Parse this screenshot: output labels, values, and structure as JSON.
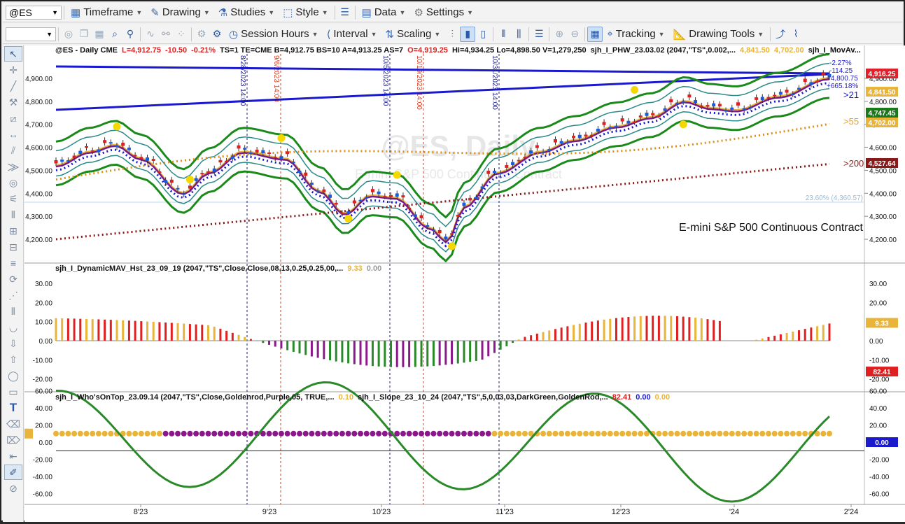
{
  "toolbar_top": {
    "symbol": "@ES",
    "items": [
      "Timeframe",
      "Drawing",
      "Studies",
      "Style",
      "Data",
      "Settings"
    ]
  },
  "toolbar_second": {
    "session": "Session Hours",
    "interval": "Interval",
    "scaling": "Scaling",
    "tracking": "Tracking",
    "drawing_tools": "Drawing Tools"
  },
  "price_pane": {
    "header": {
      "sym": "@ES - Daily  CME",
      "L": "L=4,912.75",
      "chg": "-10.50",
      "pct": "-0.21%",
      "ts": "TS=1  TE=CME  B=4,912.75  BS=10  A=4,913.25  AS=7",
      "O": "O=4,919.25",
      "hi": "Hi=4,934.25  Lo=4,898.50  V=1,279,250",
      "study": "sjh_I_PHW_23.03.02 (2047,\"TS\",0.002,...",
      "v1": "4,841.50",
      "v2": "4,702.00",
      "study2": "sjh_I_MovAv..."
    },
    "watermark": "@ES, Daily",
    "watermark_sub": "E-mini S&P 500 Continuous Contract",
    "contract": "E-mini S&P 500 Continuous Contract",
    "axis": [
      "4,900.00",
      "4,800.00",
      "4,700.00",
      "4,600.00",
      "4,500.00",
      "4,400.00",
      "4,300.00",
      "4,200.00"
    ],
    "fib": "23.60% (4,360.57)",
    "vlines": [
      {
        "label": "8/28/2023 14:00",
        "color": "#1a1a8a"
      },
      {
        "label": "9/6/2023 14:00",
        "color": "#e03a1a"
      },
      {
        "label": "10/5/2023 14:00",
        "color": "#1a1a8a"
      },
      {
        "label": "10/19/2023 14:00",
        "color": "#e03a1a"
      },
      {
        "label": "10/31/2023 14:00",
        "color": "#1a1a8a"
      }
    ],
    "annotations": {
      "a1": "-2.27%",
      "a2": "-114.25",
      "a3": "+4,800.75",
      "a4": "+665.18%",
      "ma21": ">21",
      "ma55": ">55",
      "ma200": ">200"
    },
    "price_tags": [
      {
        "text": "4,916.25",
        "bg": "#e0202a",
        "fg": "#ffffff"
      },
      {
        "text": "4,841.50",
        "bg": "#e8b43a",
        "fg": "#ffffff"
      },
      {
        "text": "4,747.45",
        "bg": "#1a7a1a",
        "fg": "#ffffff"
      },
      {
        "text": "4,702.00",
        "bg": "#e8b43a",
        "fg": "#ffffff"
      },
      {
        "text": "4,527.64",
        "bg": "#8a1a1a",
        "fg": "#ffffff"
      }
    ]
  },
  "hist_pane": {
    "title": "sjh_I_DynamicMAV_Hst_23_09_19 (2047,\"TS\",Close,Close,08,13,0.25,0.25,00,...",
    "v1": "9.33",
    "v2": "0.00",
    "axis": [
      "30.00",
      "20.00",
      "10.00",
      "0.00",
      "-10.00",
      "-20.00"
    ],
    "tag": "9.33"
  },
  "osc_pane": {
    "title": "sjh_I_Who'sOnTop_23.09.14 (2047,\"TS\",Close,Goldenrod,Purple,05,  TRUE,...",
    "v1": "0.10",
    "title2": "sjh_I_Slope_23_10_24 (2047,\"TS\",5,0,03,03,DarkGreen,GoldenRod,...",
    "v2": "82.41",
    "v3": "0.00",
    "v4": "0.00",
    "left_tag": "0.10",
    "axis": [
      "60.00",
      "40.00",
      "20.00",
      "0.00",
      "-20.00",
      "-40.00",
      "-60.00"
    ],
    "tag1": "82.41",
    "tag2": "0.00"
  },
  "xaxis": [
    "8'23",
    "9'23",
    "10'23",
    "11'23",
    "12'23",
    "'24",
    "2'24"
  ]
}
